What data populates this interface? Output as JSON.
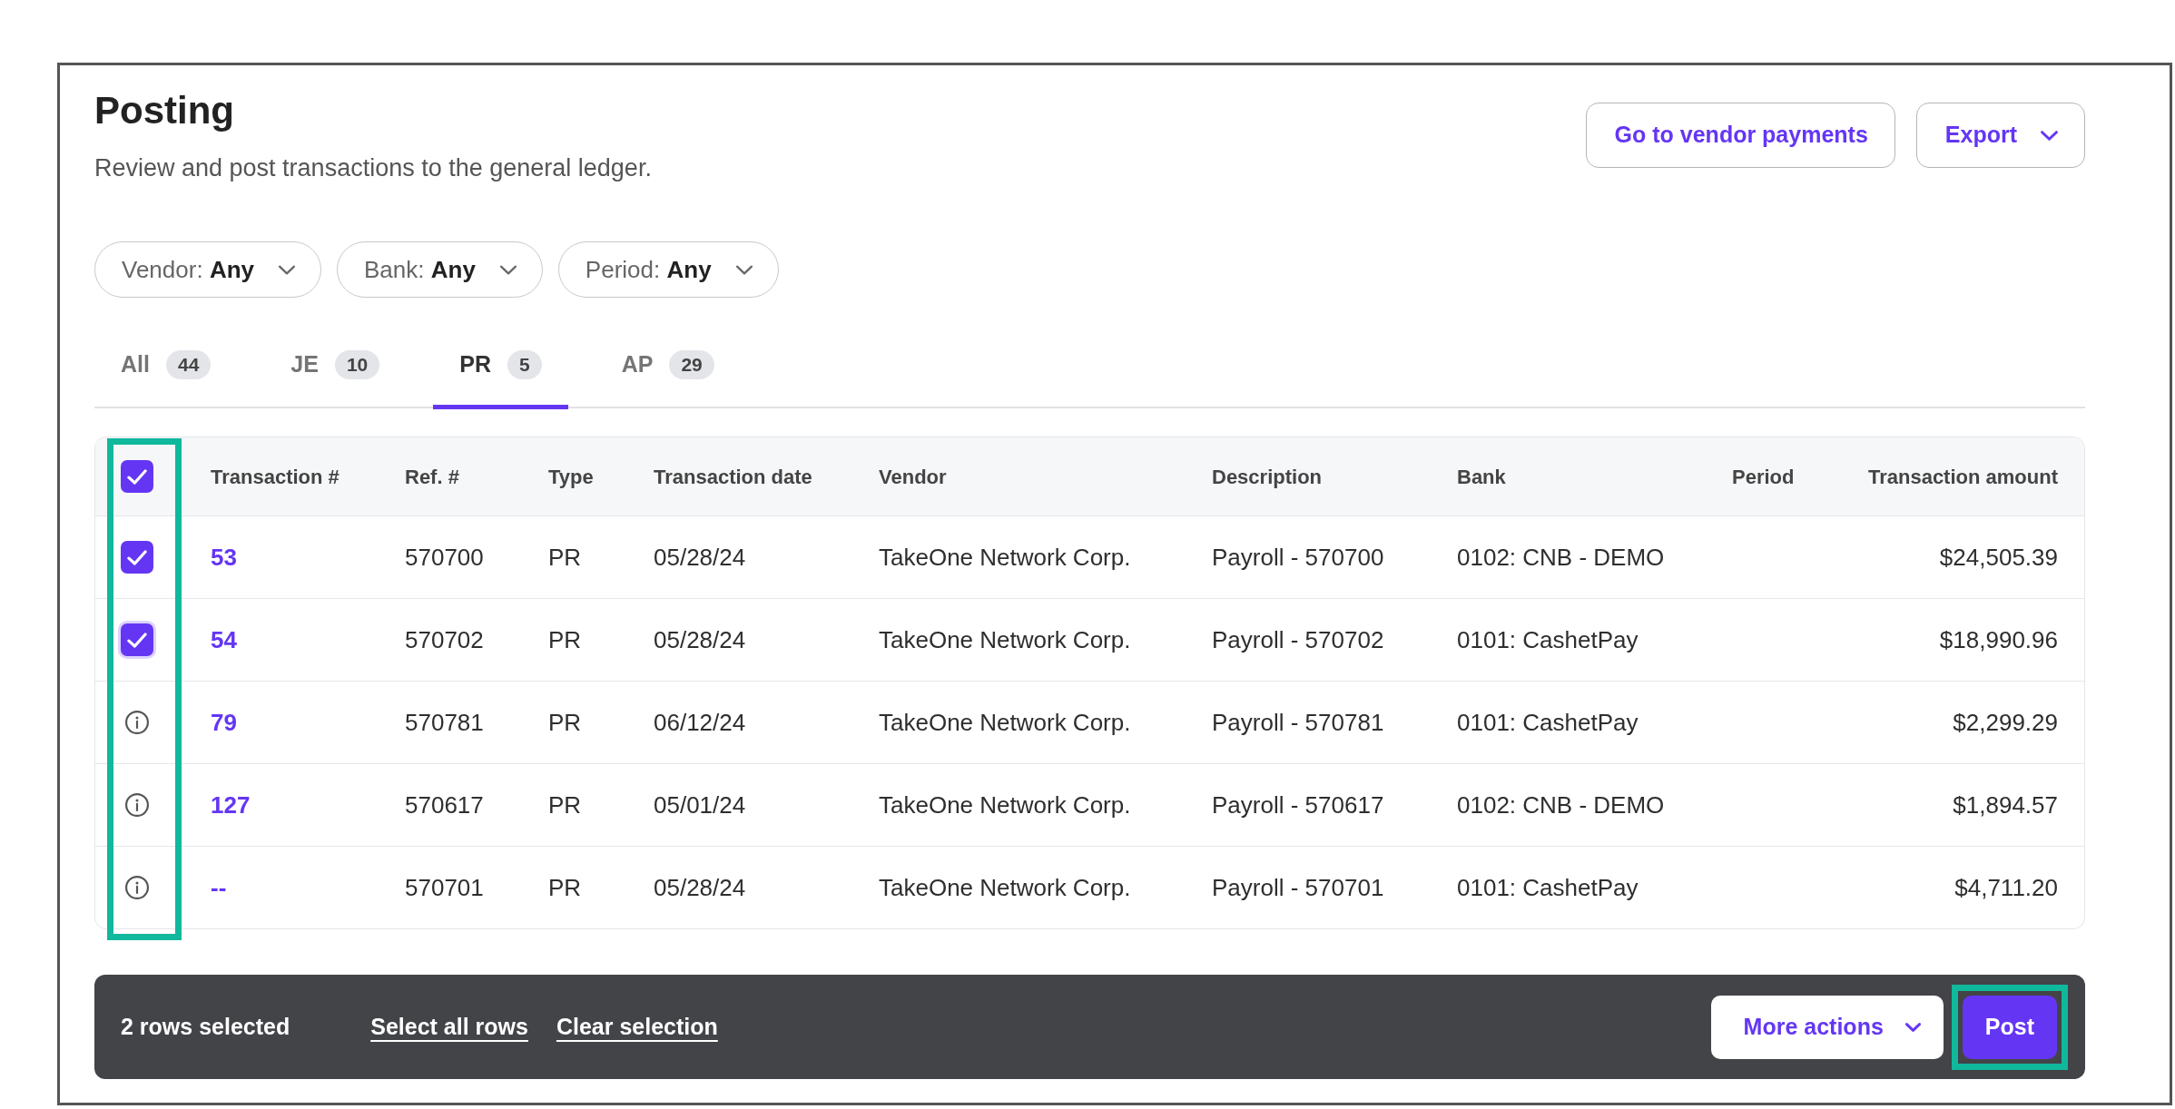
{
  "page": {
    "title": "Posting",
    "subtitle": "Review and post transactions to the general ledger."
  },
  "header_actions": [
    {
      "label": "Go to vendor payments",
      "dropdown": false
    },
    {
      "label": "Export",
      "dropdown": true
    }
  ],
  "filters": [
    {
      "label": "Vendor:",
      "value": "Any"
    },
    {
      "label": "Bank:",
      "value": "Any"
    },
    {
      "label": "Period:",
      "value": "Any"
    }
  ],
  "tabs": [
    {
      "label": "All",
      "count": "44",
      "selected": false
    },
    {
      "label": "JE",
      "count": "10",
      "selected": false
    },
    {
      "label": "PR",
      "count": "5",
      "selected": true
    },
    {
      "label": "AP",
      "count": "29",
      "selected": false
    }
  ],
  "table": {
    "select_all": {
      "checked": true
    },
    "select_column_highlighted": true,
    "columns": [
      "Transaction #",
      "Ref. #",
      "Type",
      "Transaction date",
      "Vendor",
      "Description",
      "Bank",
      "Period",
      "Transaction amount"
    ],
    "rows": [
      {
        "kind": "checkbox",
        "checked": true,
        "focused": false,
        "transaction_no": "53",
        "ref_no": "570700",
        "txn_type": "PR",
        "date": "05/28/24",
        "vendor": "TakeOne Network Corp.",
        "description": "Payroll - 570700",
        "bank": "0102: CNB - DEMO",
        "amount": "$24,505.39"
      },
      {
        "kind": "checkbox",
        "checked": true,
        "focused": true,
        "transaction_no": "54",
        "ref_no": "570702",
        "txn_type": "PR",
        "date": "05/28/24",
        "vendor": "TakeOne Network Corp.",
        "description": "Payroll - 570702",
        "bank": "0101: CashetPay",
        "amount": "$18,990.96"
      },
      {
        "kind": "info",
        "transaction_no": "79",
        "ref_no": "570781",
        "txn_type": "PR",
        "date": "06/12/24",
        "vendor": "TakeOne Network Corp.",
        "description": "Payroll - 570781",
        "bank": "0101: CashetPay",
        "amount": "$2,299.29"
      },
      {
        "kind": "info",
        "transaction_no": "127",
        "ref_no": "570617",
        "txn_type": "PR",
        "date": "05/01/24",
        "vendor": "TakeOne Network Corp.",
        "description": "Payroll - 570617",
        "bank": "0102: CNB - DEMO",
        "amount": "$1,894.57"
      },
      {
        "kind": "info",
        "transaction_no": "--",
        "ref_no": "570701",
        "txn_type": "PR",
        "date": "05/28/24",
        "vendor": "TakeOne Network Corp.",
        "description": "Payroll - 570701",
        "bank": "0101: CashetPay",
        "amount": "$4,711.20"
      }
    ]
  },
  "selection_bar": {
    "summary": "2 rows selected",
    "links": [
      "Select all rows",
      "Clear selection"
    ],
    "actions": [
      {
        "kind": "secondary",
        "label": "More actions",
        "dropdown": true,
        "highlighted": false
      },
      {
        "kind": "primary",
        "label": "Post",
        "dropdown": false,
        "highlighted": true
      }
    ]
  }
}
